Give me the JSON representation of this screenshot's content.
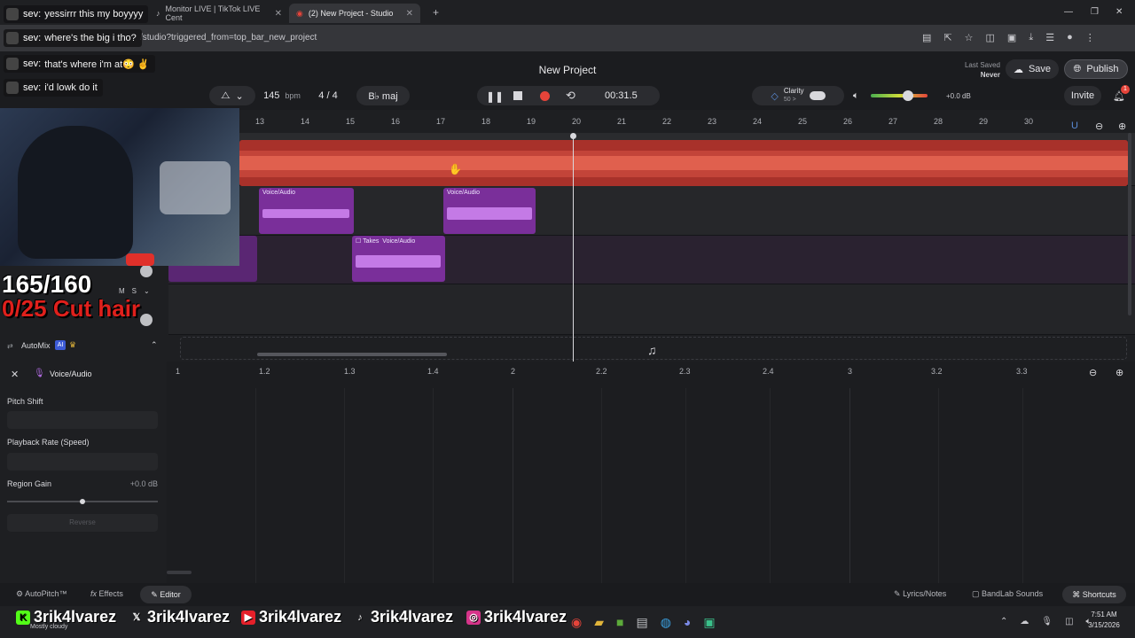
{
  "browser": {
    "tabs": [
      {
        "label": "Monitor LIVE | TikTok LIVE Cent",
        "active": false
      },
      {
        "label": "(2) New Project - Studio",
        "active": true
      }
    ],
    "url": "/studio?triggered_from=top_bar_new_project"
  },
  "app": {
    "title": "New Project",
    "last_saved_label": "Last Saved",
    "last_saved_value": "Never",
    "save_label": "Save",
    "publish_label": "Publish",
    "invite_label": "Invite",
    "notification_count": "1",
    "tempo": "145",
    "tempo_unit": "bpm",
    "time_sig": "4 / 4",
    "key": "B♭ maj",
    "time": "00:31.5",
    "clarity_label": "Clarity",
    "clarity_value": "50 >",
    "master_gain": "+0.0 dB",
    "ruler": [
      "13",
      "14",
      "15",
      "16",
      "17",
      "18",
      "19",
      "20",
      "21",
      "22",
      "23",
      "24",
      "25",
      "26",
      "27",
      "28",
      "29",
      "30"
    ]
  },
  "clips": {
    "voice_a": "Voice/Audio",
    "voice_b": "Voice/Audio",
    "takes_label": "Takes",
    "voice_c": "Voice/Audio"
  },
  "left_panel": {
    "automix_label": "AutoMix",
    "ai_badge": "AI",
    "track_name": "Voice/Audio",
    "pitch_shift": "Pitch Shift",
    "playback_rate": "Playback Rate (Speed)",
    "region_gain": "Region Gain",
    "region_gain_value": "+0.0 dB",
    "reverse": "Reverse",
    "mute": "M",
    "solo": "S"
  },
  "editor_ruler": [
    "1",
    "1.2",
    "1.3",
    "1.4",
    "2",
    "2.2",
    "2.3",
    "2.4",
    "3",
    "3.2",
    "3.3"
  ],
  "footer": {
    "autopitch": "AutoPitch™",
    "effects": "Effects",
    "editor": "Editor",
    "lyrics": "Lyrics/Notes",
    "sounds": "BandLab Sounds",
    "shortcuts": "Shortcuts"
  },
  "overlay": {
    "chat": [
      {
        "name": "sev:",
        "text": "yessirrr this my boyyyy"
      },
      {
        "name": "sev:",
        "text": "where's the big i tho?"
      },
      {
        "name": "sev:",
        "text": "that's where i'm at😳 ✌"
      },
      {
        "name": "sev:",
        "text": "i'd lowk do it"
      }
    ],
    "counter": "165/160",
    "goal": "0/25 Cut hair",
    "socials": [
      "3rik4lvarez",
      "3rik4lvarez",
      "3rik4lvarez",
      "3rik4lvarez",
      "3rik4lvarez"
    ]
  },
  "taskbar": {
    "weather": "Mostly cloudy",
    "time": "7:51 AM",
    "date": "3/15/2026"
  }
}
